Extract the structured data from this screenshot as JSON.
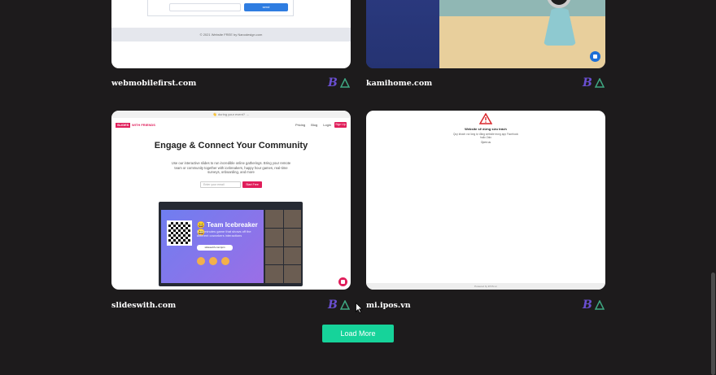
{
  "cards": [
    {
      "site": "webmobilefirst.com",
      "preview": {
        "button": "send",
        "footer": "© 2021 Website FREE by Nanodesign.com"
      }
    },
    {
      "site": "kamihome.com"
    },
    {
      "site": "slideswith.com",
      "preview": {
        "topbar": "👋 during your event? →",
        "logo_box": "SLIDES",
        "logo_text": "WITH FRIENDS",
        "nav_links": [
          "Pricing",
          "Blog",
          "Login"
        ],
        "signup": "Sign Up",
        "hero_title": "Engage & Connect Your Community",
        "hero_sub": "Use our interactive slides to run incredible online gatherings. Bring your remote team or community together with icebreakers, happy hour games, real-time surveys, onboarding, and more",
        "email_placeholder": "Enter your email",
        "start_button": "Start Free",
        "slide_title": "😄 Team Icebreaker 😄",
        "slide_sub": "5-10 minutes game that shows off the different coworkers interactions",
        "slide_url": "slideswith.com/join"
      }
    },
    {
      "site": "mi.ipos.vn",
      "preview": {
        "warn_title": "Website sẽ dừng sửu trách",
        "warn_text": "Quý khách vui lòng tự đăng website trong app Facebook hoặc Zalo",
        "warn_link": "Open us",
        "footer": "Powered by iPOS.vn"
      }
    }
  ],
  "load_more_label": "Load More",
  "colors": {
    "background": "#1d1b1c",
    "badge_purple": "#6a4fd1",
    "badge_green": "#3fa882",
    "load_more": "#16d39a"
  },
  "icons": {
    "badge_b": "bootstrap-icon",
    "badge_triangle": "vue-icon"
  }
}
